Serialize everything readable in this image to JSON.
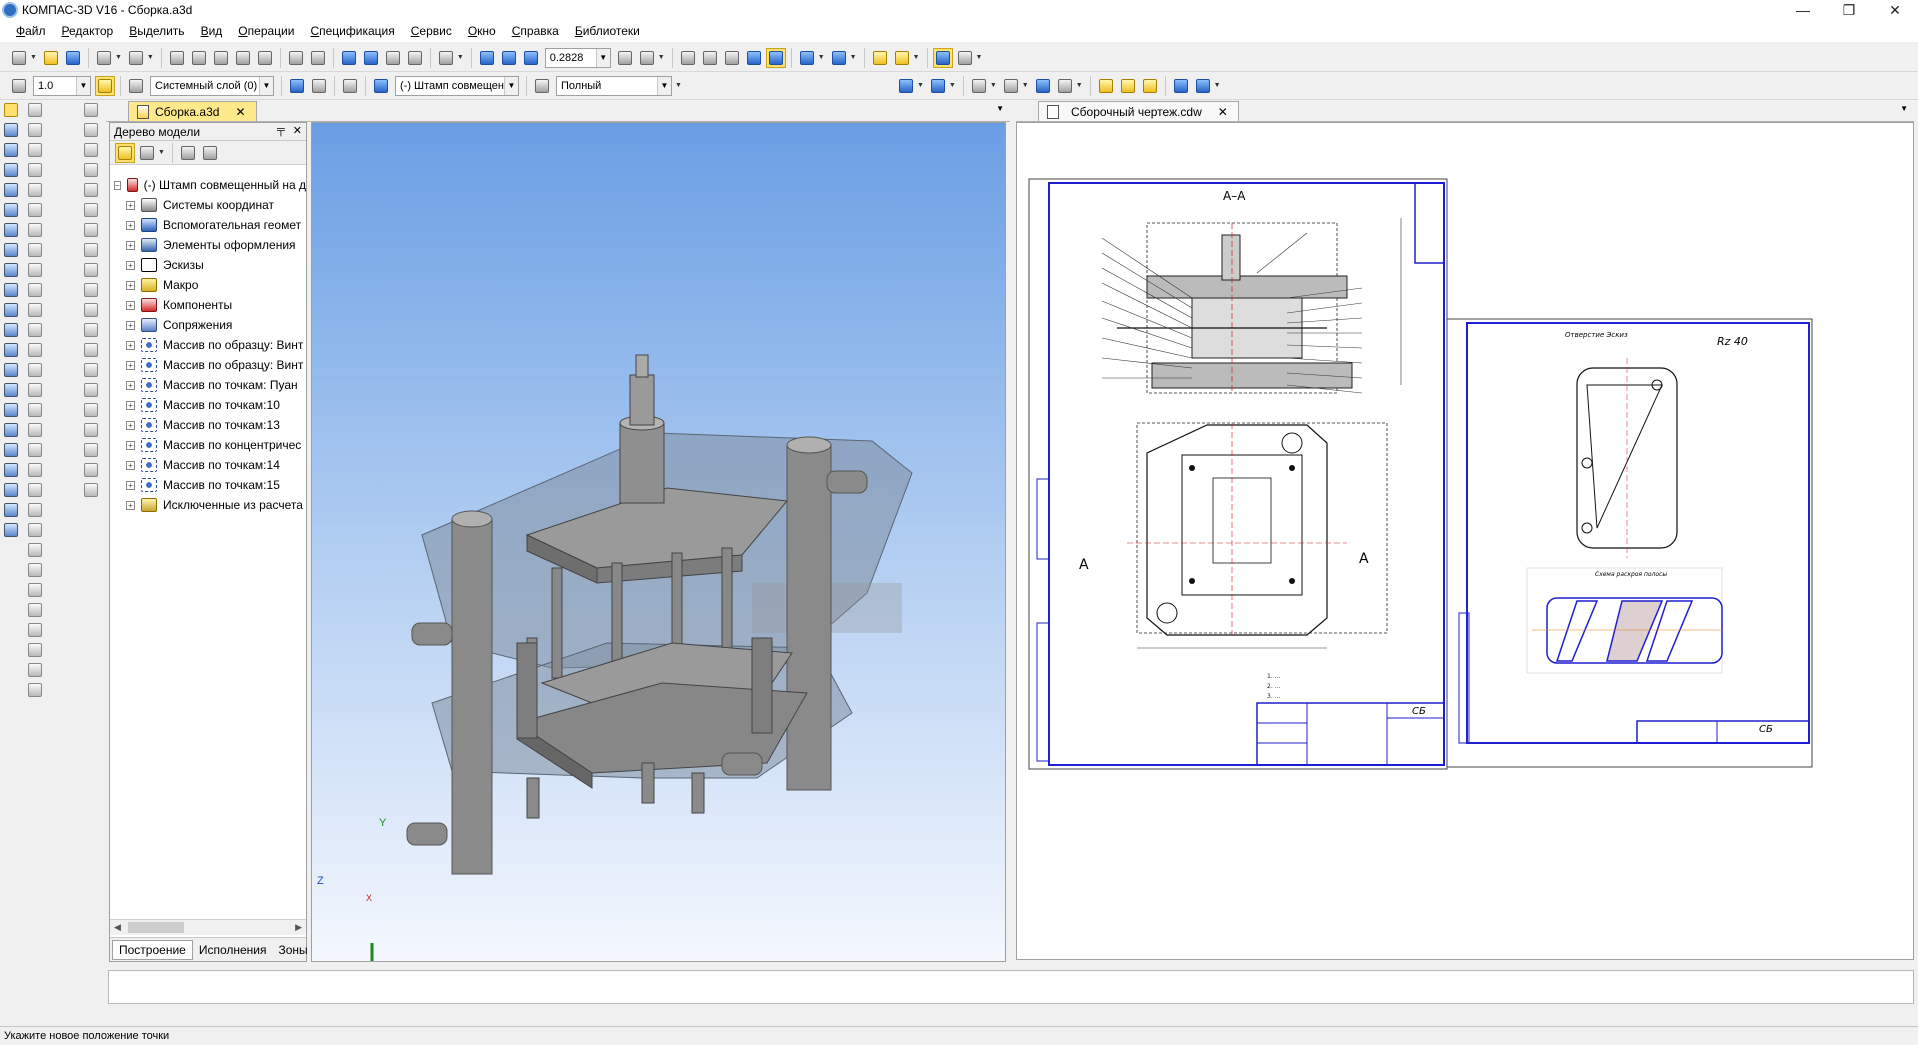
{
  "window": {
    "title": "КОМПАС-3D V16  - Сборка.a3d",
    "controls": [
      "—",
      "❐",
      "✕"
    ]
  },
  "menu": [
    "Файл",
    "Редактор",
    "Выделить",
    "Вид",
    "Операции",
    "Спецификация",
    "Сервис",
    "Окно",
    "Справка",
    "Библиотеки"
  ],
  "toolbar1": {
    "zoom_value": "0.2828"
  },
  "toolbar2": {
    "scale_value": "1.0",
    "layer_value": "Системный слой (0)",
    "object_value": "(-) Штамп совмещен",
    "view_mode_value": "Полный"
  },
  "tabs": {
    "left_doc": "Сборка.a3d",
    "right_doc": "Сборочный чертеж.cdw",
    "close": "✕"
  },
  "tree": {
    "header": "Дерево модели",
    "pin": "╤",
    "close": "✕",
    "root": "(-) Штамп совмещенный на д",
    "items": [
      {
        "label": "Системы координат",
        "icon": "coord"
      },
      {
        "label": "Вспомогательная геомет",
        "icon": "geom"
      },
      {
        "label": "Элементы оформления",
        "icon": "ann"
      },
      {
        "label": "Эскизы",
        "icon": "sketch"
      },
      {
        "label": "Макро",
        "icon": "macro"
      },
      {
        "label": "Компоненты",
        "icon": "comp"
      },
      {
        "label": "Сопряжения",
        "icon": "mate"
      },
      {
        "label": "Массив по образцу: Винт",
        "icon": "arr"
      },
      {
        "label": "Массив по образцу: Винт",
        "icon": "arr"
      },
      {
        "label": "Массив по точкам: Пуан",
        "icon": "arr"
      },
      {
        "label": "Массив по точкам:10",
        "icon": "arr"
      },
      {
        "label": "Массив по точкам:13",
        "icon": "arr"
      },
      {
        "label": "Массив по концентричес",
        "icon": "arr"
      },
      {
        "label": "Массив по точкам:14",
        "icon": "arr"
      },
      {
        "label": "Массив по точкам:15",
        "icon": "arr"
      },
      {
        "label": "Исключенные из расчета",
        "icon": "excl"
      }
    ],
    "bottom_tabs": [
      "Построение",
      "Исполнения",
      "Зоны"
    ]
  },
  "axes": {
    "y": "Y",
    "z": "Z",
    "x": "X"
  },
  "drawing": {
    "section_label": "А–А",
    "cut_label_left": "А",
    "cut_label_right": "А",
    "stamp_code": "СБ",
    "sheet2_title": "Отверстие Эскиз",
    "sheet2_roughness": "Rz 40",
    "sheet2_subtitle": "Схема раскроя полосы",
    "sheet2_stamp_code": "СБ"
  },
  "status": {
    "hint": "Укажите новое положение точки"
  }
}
